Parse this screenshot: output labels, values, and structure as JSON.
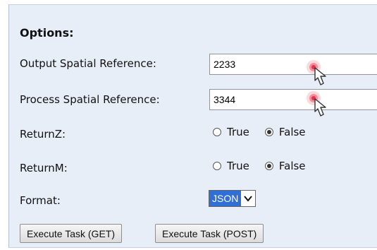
{
  "options": {
    "heading": "Options:",
    "output_sr": {
      "label": "Output Spatial Reference:",
      "value": "2233"
    },
    "process_sr": {
      "label": "Process Spatial Reference:",
      "value": "3344"
    },
    "returnz": {
      "label": "ReturnZ:",
      "true_label": "True",
      "false_label": "False",
      "selected": "False"
    },
    "returnm": {
      "label": "ReturnM:",
      "true_label": "True",
      "false_label": "False",
      "selected": "False"
    },
    "format": {
      "label": "Format:",
      "selected": "JSON"
    }
  },
  "buttons": {
    "get_label": "Execute Task (GET)",
    "post_label": "Execute Task (POST)"
  },
  "colors": {
    "panel_bg": "#e8eef8",
    "select_highlight": "#2f6fd6",
    "click_indicator": "#e8324a"
  },
  "icons": [
    "hand-pointer-icon",
    "chevron-down-icon"
  ]
}
